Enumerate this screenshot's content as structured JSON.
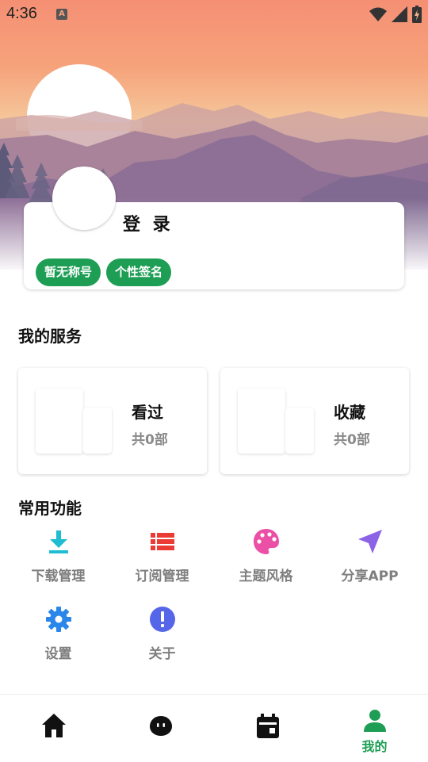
{
  "status_bar": {
    "time": "4:36",
    "notification_icon": "A"
  },
  "profile": {
    "login_label": "登 录",
    "tags": [
      "暂无称号",
      "个性签名"
    ]
  },
  "services": {
    "title": "我的服务",
    "items": [
      {
        "name": "看过",
        "count": "共0部"
      },
      {
        "name": "收藏",
        "count": "共0部"
      }
    ]
  },
  "functions": {
    "title": "常用功能",
    "items": [
      {
        "label": "下载管理",
        "icon": "download-icon",
        "color": "#1fbcd2"
      },
      {
        "label": "订阅管理",
        "icon": "list-icon",
        "color": "#ea3b35"
      },
      {
        "label": "主题风格",
        "icon": "palette-icon",
        "color": "#ec4fa6"
      },
      {
        "label": "分享APP",
        "icon": "send-icon",
        "color": "#8c63e6"
      },
      {
        "label": "设置",
        "icon": "gear-icon",
        "color": "#2a86e8"
      },
      {
        "label": "关于",
        "icon": "info-icon",
        "color": "#5666e8"
      }
    ]
  },
  "bottom_nav": {
    "items": [
      {
        "icon": "home-icon",
        "label": ""
      },
      {
        "icon": "cat-face-icon",
        "label": ""
      },
      {
        "icon": "calendar-icon",
        "label": ""
      },
      {
        "icon": "person-icon",
        "label": "我的"
      }
    ],
    "active_color": "#1e9e54"
  }
}
